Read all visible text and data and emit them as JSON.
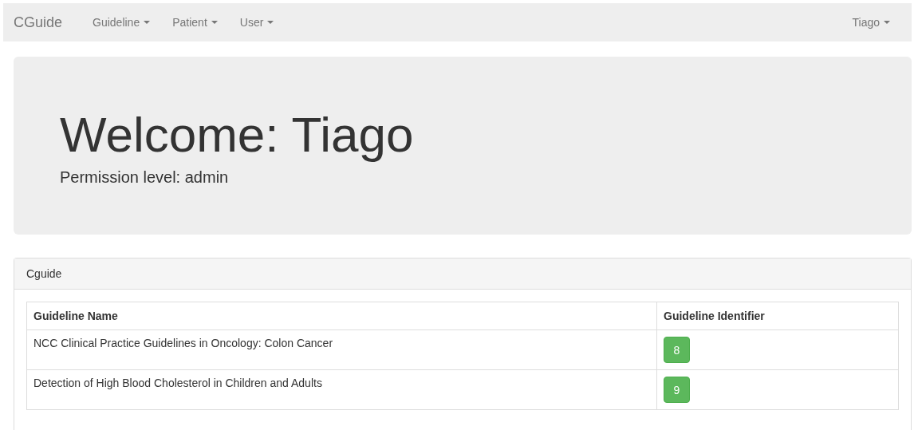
{
  "navbar": {
    "brand": "CGuide",
    "menus": [
      {
        "label": "Guideline"
      },
      {
        "label": "Patient"
      },
      {
        "label": "User"
      }
    ],
    "user_menu": {
      "label": "Tiago"
    }
  },
  "jumbotron": {
    "heading": "Welcome: Tiago",
    "subheading": "Permission level: admin"
  },
  "panel": {
    "title": "Cguide",
    "table": {
      "columns": [
        "Guideline Name",
        "Guideline Identifier"
      ],
      "rows": [
        {
          "name": "NCC Clinical Practice Guidelines in Oncology: Colon Cancer",
          "identifier": "8"
        },
        {
          "name": "Detection of High Blood Cholesterol in Children and Adults",
          "identifier": "9"
        }
      ]
    }
  }
}
